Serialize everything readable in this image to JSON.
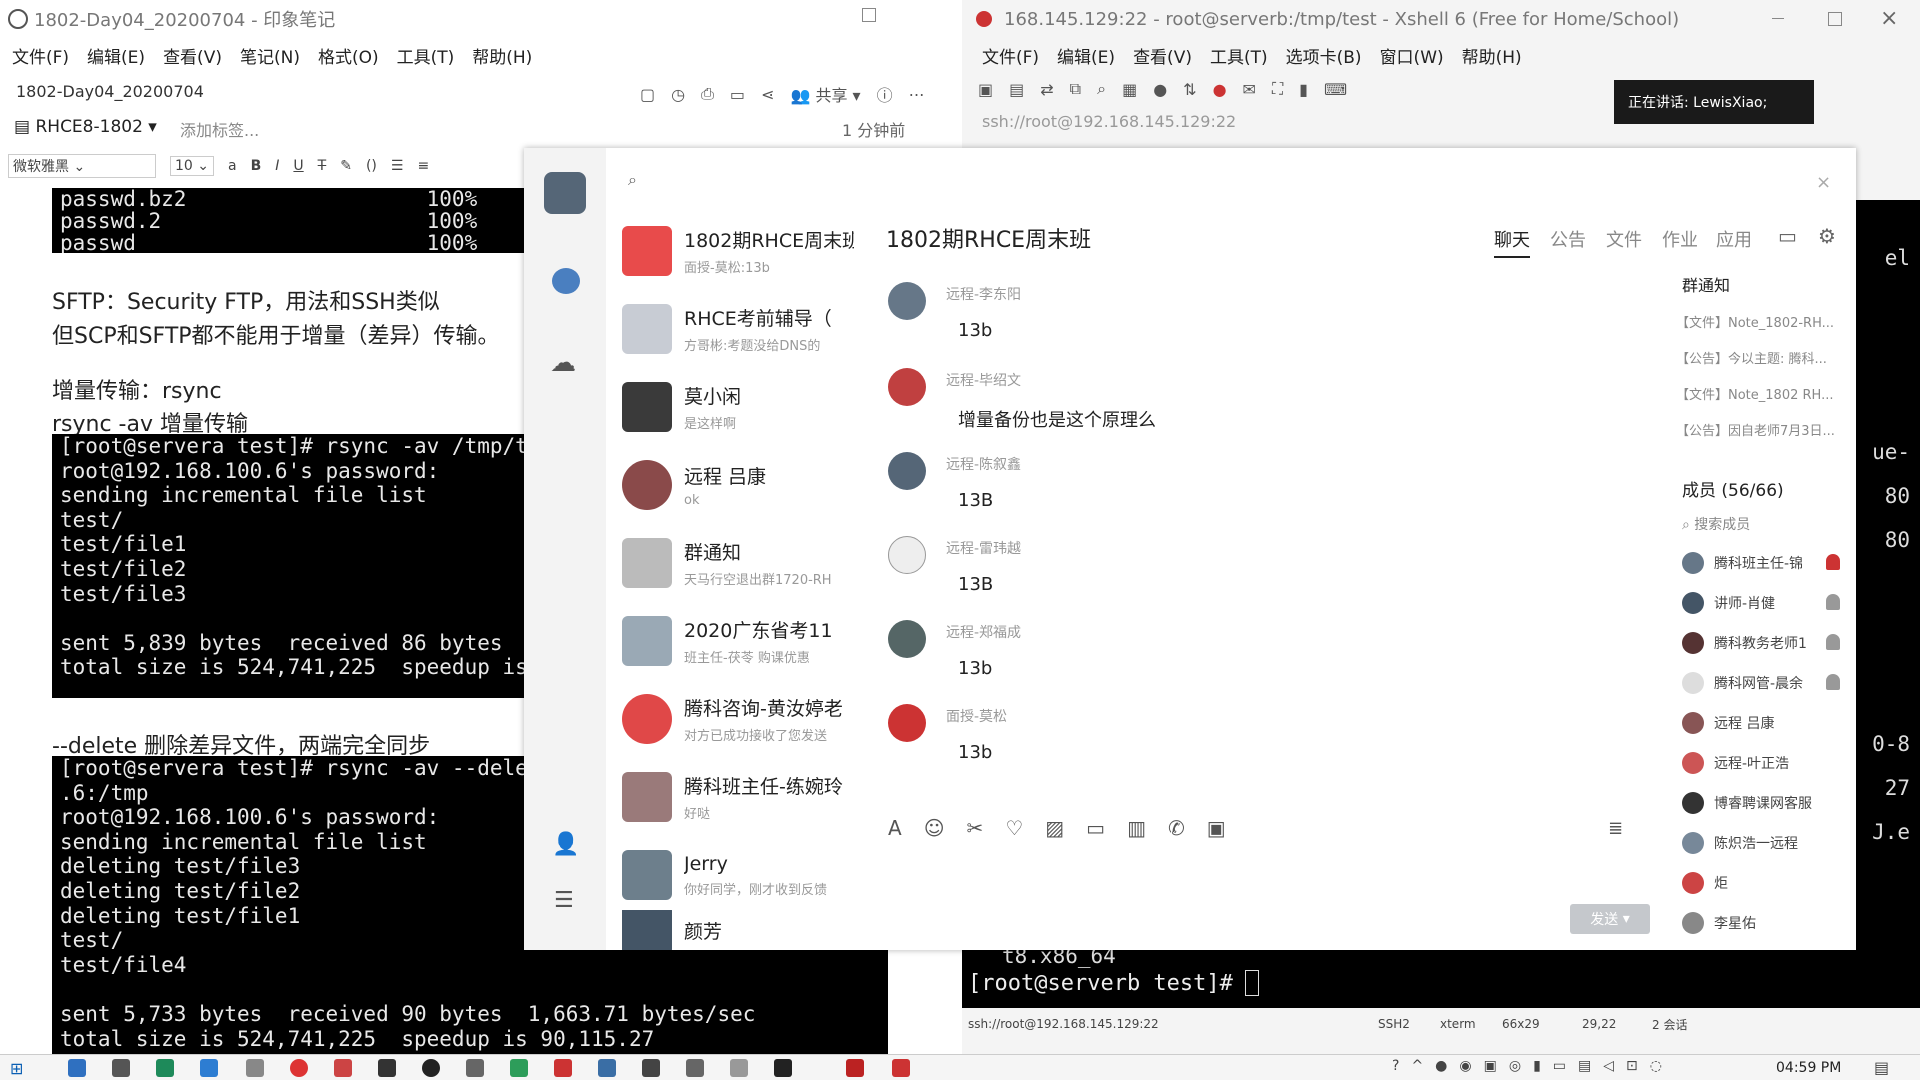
{
  "note": {
    "title": "1802-Day04_20200704 - 印象笔记",
    "menu": [
      "文件(F)",
      "编辑(E)",
      "查看(V)",
      "笔记(N)",
      "格式(O)",
      "工具(T)",
      "帮助(H)"
    ],
    "note_title": "1802-Day04_20200704",
    "share_label": "共享",
    "notebook": "RHCE8-1802",
    "add_tag": "添加标签...",
    "modified": "1 分钟前",
    "font_name": "微软雅黑",
    "font_size": "10",
    "term1": "passwd.bz2                   100%\npasswd.2                     100%\npasswd                       100%",
    "text_sftp1": "SFTP：Security FTP，用法和SSH类似",
    "text_sftp2": "但SCP和SFTP都不能用于增量（差异）传输。",
    "text_inc1": "增量传输：rsync",
    "text_inc2": "rsync -av  增量传输",
    "term2": "[root@servera test]# rsync -av /tmp/t\nroot@192.168.100.6's password:\nsending incremental file list\ntest/\ntest/file1\ntest/file2\ntest/file3\n\nsent 5,839 bytes  received 86 bytes\ntotal size is 524,741,225  speedup is",
    "text_delete": "--delete 删除差异文件，两端完全同步",
    "term3": "[root@servera test]# rsync -av --dele\n.6:/tmp\nroot@192.168.100.6's password:\nsending incremental file list\ndeleting test/file3\ndeleting test/file2\ndeleting test/file1\ntest/\ntest/file4\n\nsent 5,733 bytes  received 90 bytes  1,663.71 bytes/sec\ntotal size is 524,741,225  speedup is 90,115.27"
  },
  "xshell": {
    "title": "168.145.129:22 - root@serverb:/tmp/test - Xshell 6 (Free for Home/School)",
    "menu": [
      "文件(F)",
      "编辑(E)",
      "查看(V)",
      "工具(T)",
      "选项卡(B)",
      "窗口(W)",
      "帮助(H)"
    ],
    "address": "ssh://root@192.168.145.129:22",
    "speaking": "正在讲话: LewisXiao;",
    "right_term": [
      "el",
      "ue-",
      "80",
      "80",
      "0-8",
      "27",
      "J.e"
    ],
    "prompt_above": "t8.x86_64",
    "prompt": "[root@serverb test]#",
    "status": {
      "conn": "ssh://root@192.168.145.129:22",
      "proto": "SSH2",
      "term": "xterm",
      "size": "66x29",
      "pos": "29,22",
      "sessions": "2 会话"
    }
  },
  "qq": {
    "chats": [
      {
        "name": "1802期RHCE周末班",
        "preview": "面授-莫松:13b",
        "color": "#e84b4b"
      },
      {
        "name": "RHCE考前辅导（",
        "preview": "方哥彬:考题没给DNS的",
        "color": "#c8ccd4"
      },
      {
        "name": "莫小闲",
        "preview": "是这样啊",
        "color": "#3a3a3a"
      },
      {
        "name": "远程 吕康",
        "preview": "ok",
        "color": "#8a4a4a"
      },
      {
        "name": "群通知",
        "preview": "天马行空退出群1720-RH",
        "color": "#bbbbbb"
      },
      {
        "name": "2020广东省考11",
        "preview": "班主任-茯苓 购课优惠",
        "color": "#9aa9b5"
      },
      {
        "name": "腾科咨询-黄汝婷老",
        "preview": "对方已成功接收了您发送",
        "color": "#e04848"
      },
      {
        "name": "腾科班主任-练婉玲",
        "preview": "好哒",
        "color": "#9a7a7a"
      },
      {
        "name": "Jerry",
        "preview": "你好同学，刚才收到反馈",
        "color": "#6d7f8c"
      },
      {
        "name": "颜芳",
        "preview": "",
        "color": "#445566"
      }
    ],
    "group_title": "1802期RHCE周末班",
    "tabs": [
      "聊天",
      "公告",
      "文件",
      "作业",
      "应用"
    ],
    "messages": [
      {
        "sender": "远程-李东阳",
        "text": "13b",
        "color": "#667788"
      },
      {
        "sender": "远程-毕绍文",
        "text": "增量备份也是这个原理么",
        "color": "#c04040"
      },
      {
        "sender": "远程-陈叙鑫",
        "text": "13B",
        "color": "#556677"
      },
      {
        "sender": "远程-雷玮越",
        "text": "13B",
        "color": "#eeeeee"
      },
      {
        "sender": "远程-郑福成",
        "text": "13b",
        "color": "#556666"
      },
      {
        "sender": "面授-莫松",
        "text": "13b",
        "color": "#cc3333"
      }
    ],
    "notice_title": "群通知",
    "notices": [
      "【文件】Note_1802-RH...",
      "【公告】今以主题: 腾科...",
      "【文件】Note_1802 RH...",
      "【公告】因自老师7月3日..."
    ],
    "members_title": "成员 (56/66)",
    "member_search": "搜索成员",
    "members": [
      {
        "name": "腾科班主任-锦",
        "color": "#667788"
      },
      {
        "name": "讲师-肖健",
        "color": "#445566"
      },
      {
        "name": "腾科教务老师1",
        "color": "#553333"
      },
      {
        "name": "腾科网管-晨余",
        "color": "#dddddd"
      },
      {
        "name": "远程 吕康",
        "color": "#885555"
      },
      {
        "name": "远程-叶正浩",
        "color": "#cc5555"
      },
      {
        "name": "博睿聘课网客服",
        "color": "#333333"
      },
      {
        "name": "陈炽浩一远程",
        "color": "#778899"
      },
      {
        "name": "炬",
        "color": "#cc4444"
      },
      {
        "name": "李星佑",
        "color": "#888888"
      }
    ],
    "send": "发送"
  },
  "taskbar": {
    "time": "04:59 PM"
  }
}
